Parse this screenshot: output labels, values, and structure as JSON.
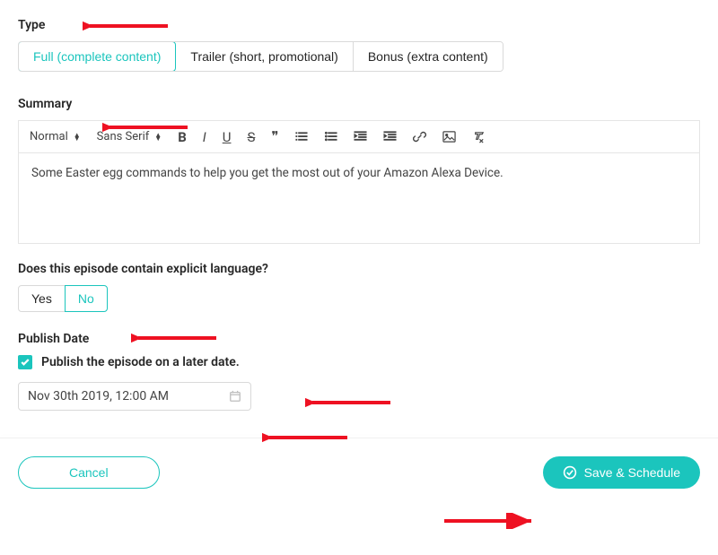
{
  "type": {
    "label": "Type",
    "options": [
      {
        "label": "Full (complete content)",
        "selected": true
      },
      {
        "label": "Trailer (short, promotional)",
        "selected": false
      },
      {
        "label": "Bonus (extra content)",
        "selected": false
      }
    ]
  },
  "summary": {
    "label": "Summary",
    "toolbar": {
      "paragraph": "Normal",
      "font": "Sans Serif"
    },
    "content": "Some Easter egg commands to help you get the most out of your Amazon Alexa Device."
  },
  "explicit": {
    "label": "Does this episode contain explicit language?",
    "options": [
      {
        "label": "Yes",
        "selected": false
      },
      {
        "label": "No",
        "selected": true
      }
    ]
  },
  "publish": {
    "label": "Publish Date",
    "checkbox_label": "Publish the episode on a later date.",
    "checked": true,
    "date_value": "Nov 30th 2019, 12:00 AM"
  },
  "footer": {
    "cancel": "Cancel",
    "save": "Save & Schedule"
  }
}
